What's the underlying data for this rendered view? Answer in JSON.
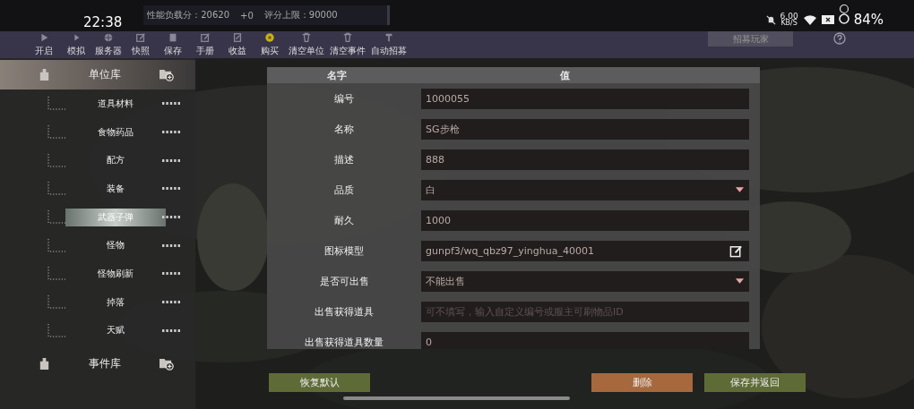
{
  "status_bar": {
    "time": "22:38",
    "network_speed": "6.00",
    "network_unit": "KB/S",
    "battery": "84%"
  },
  "score_strip": {
    "load_score": "性能负载分：20620",
    "delta": "+0",
    "score_limit": "评分上限：90000"
  },
  "toolbar": [
    {
      "label": "开启",
      "kind": "play"
    },
    {
      "label": "模拟",
      "kind": "play-small"
    },
    {
      "label": "服务器",
      "kind": "globe"
    },
    {
      "label": "快照",
      "kind": "edit"
    },
    {
      "label": "保存",
      "kind": "save"
    },
    {
      "label": "手册",
      "kind": "edit"
    },
    {
      "label": "收益",
      "kind": "doc"
    },
    {
      "label": "购买",
      "kind": "coin"
    },
    {
      "label": "清空单位",
      "kind": "trash"
    },
    {
      "label": "清空事件",
      "kind": "trash"
    },
    {
      "label": "自动招募",
      "kind": "hammer"
    }
  ],
  "recruit_button": "招募玩家",
  "sidebar": {
    "groups": [
      {
        "label": "单位库",
        "selected": true,
        "children": [
          {
            "label": "道具材料",
            "selected": false
          },
          {
            "label": "食物药品",
            "selected": false
          },
          {
            "label": "配方",
            "selected": false
          },
          {
            "label": "装备",
            "selected": false
          },
          {
            "label": "武器子弹",
            "selected": true
          },
          {
            "label": "怪物",
            "selected": false
          },
          {
            "label": "怪物刷新",
            "selected": false
          },
          {
            "label": "掉落",
            "selected": false
          },
          {
            "label": "天赋",
            "selected": false
          }
        ]
      },
      {
        "label": "事件库",
        "selected": false
      }
    ]
  },
  "form": {
    "columns": [
      "名字",
      "值"
    ],
    "rows": [
      {
        "label": "编号",
        "kind": "text",
        "value": "1000055"
      },
      {
        "label": "名称",
        "kind": "text",
        "value": "SG步枪"
      },
      {
        "label": "描述",
        "kind": "text",
        "value": "888"
      },
      {
        "label": "品质",
        "kind": "select",
        "value": "白"
      },
      {
        "label": "耐久",
        "kind": "text",
        "value": "1000"
      },
      {
        "label": "图标模型",
        "kind": "edit",
        "value": "gunpf3/wq_qbz97_yinghua_40001"
      },
      {
        "label": "是否可出售",
        "kind": "select",
        "value": "不能出售"
      },
      {
        "label": "出售获得道具",
        "kind": "text",
        "placeholder": "可不填写，输入自定义编号或服主可刷物品ID"
      },
      {
        "label": "出售获得道具数量",
        "kind": "text",
        "value": "0"
      }
    ]
  },
  "buttons": [
    {
      "label": "恢复默认",
      "kind": "reset"
    },
    {
      "label": "删除",
      "kind": "delete"
    },
    {
      "label": "保存并返回",
      "kind": "save"
    }
  ]
}
